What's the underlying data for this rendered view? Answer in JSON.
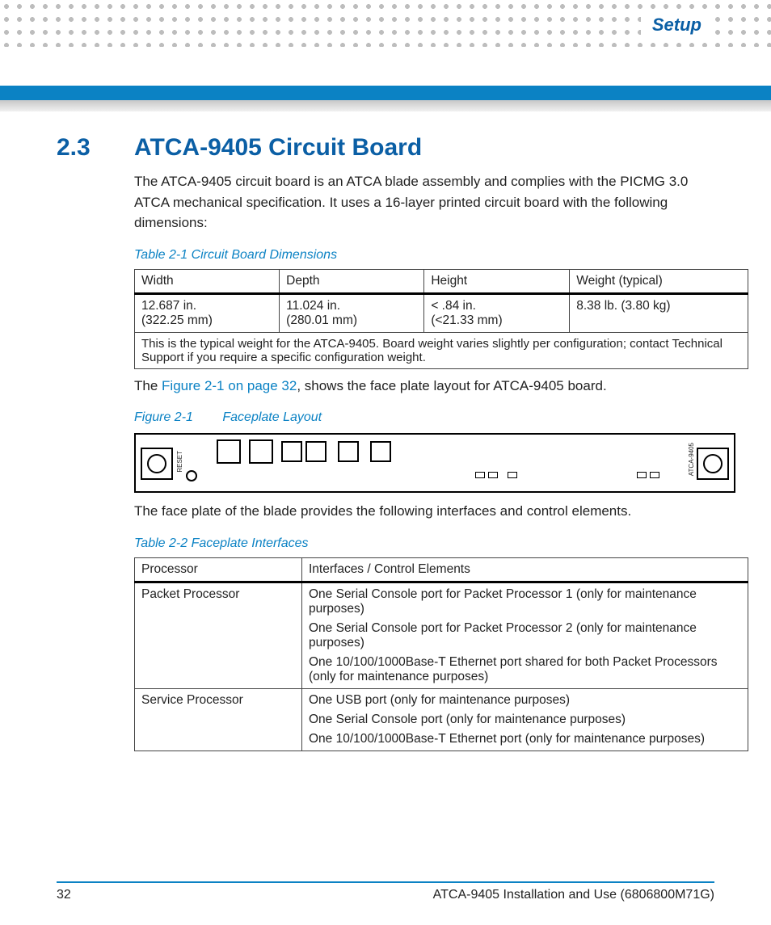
{
  "header": {
    "chapter": "Setup"
  },
  "section": {
    "number": "2.3",
    "title": "ATCA-9405 Circuit Board",
    "intro": "The ATCA-9405 circuit board is an ATCA blade assembly and complies with the PICMG 3.0 ATCA mechanical specification. It uses a 16-layer printed circuit board with the following dimensions:"
  },
  "table1": {
    "caption": "Table 2-1 Circuit Board Dimensions",
    "headers": [
      "Width",
      "Depth",
      "Height",
      "Weight (typical)"
    ],
    "row": {
      "width_in": "12.687 in.",
      "width_mm": "(322.25 mm)",
      "depth_in": "11.024 in.",
      "depth_mm": "(280.01 mm)",
      "height_in": "< .84 in.",
      "height_mm": "(<21.33 mm)",
      "weight": "8.38 lb. (3.80 kg)"
    },
    "note": "This is the typical weight for the ATCA-9405. Board weight varies slightly per configuration; contact Technical Support if you require a specific configuration weight."
  },
  "figure": {
    "lead_pre": "The ",
    "xref": "Figure 2-1 on page 32",
    "lead_post": ", shows the face plate layout for ATCA-9405 board.",
    "caption_label": "Figure 2-1",
    "caption_title": "Faceplate Layout",
    "reset_label": "RESET",
    "board_label": "ATCA-9405"
  },
  "midtext": "The face plate of the blade provides the following interfaces and control elements.",
  "table2": {
    "caption": "Table 2-2 Faceplate Interfaces",
    "headers": [
      "Processor",
      "Interfaces / Control Elements"
    ],
    "rows": [
      {
        "proc": "Packet Processor",
        "items": [
          "One Serial Console port for Packet Processor 1 (only for maintenance purposes)",
          "One Serial Console port for Packet Processor 2 (only for maintenance purposes)",
          "One 10/100/1000Base-T Ethernet port shared for both Packet Processors (only for maintenance purposes)"
        ]
      },
      {
        "proc": "Service Processor",
        "items": [
          "One USB port (only for maintenance purposes)",
          "One Serial Console port (only for maintenance purposes)",
          "One 10/100/1000Base-T Ethernet port (only for maintenance purposes)"
        ]
      }
    ]
  },
  "footer": {
    "page": "32",
    "doc": "ATCA-9405 Installation and Use (6806800M71G)"
  }
}
